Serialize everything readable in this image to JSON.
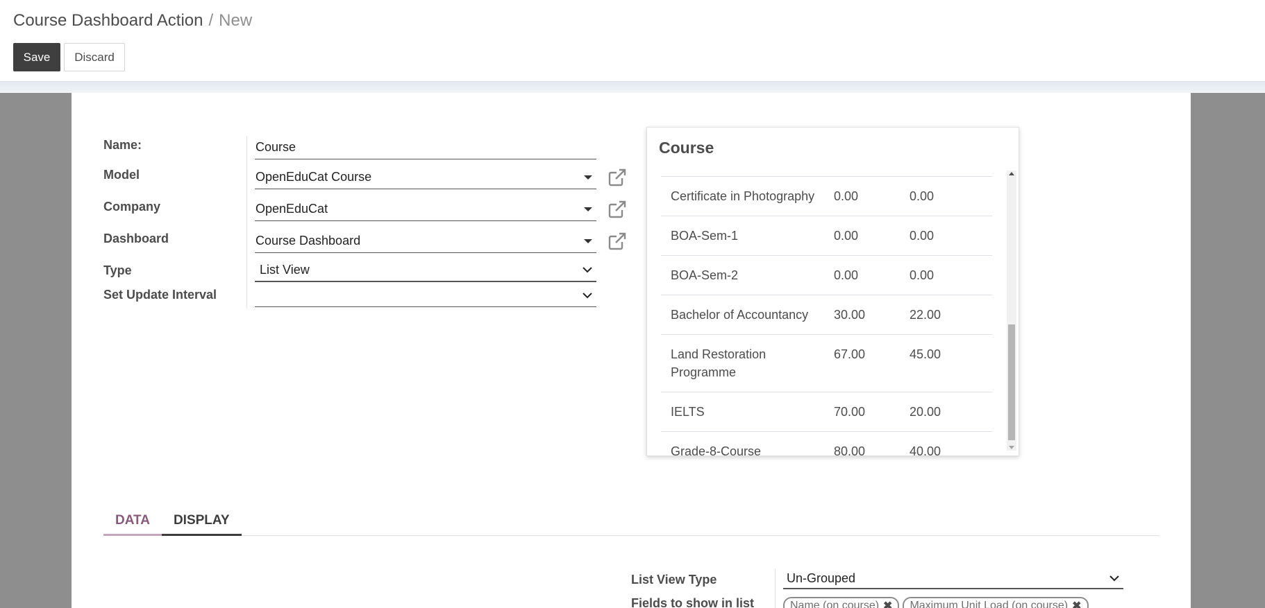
{
  "breadcrumb": {
    "parent": "Course Dashboard Action",
    "separator": "/",
    "current": "New"
  },
  "buttons": {
    "save": "Save",
    "discard": "Discard"
  },
  "form": {
    "name": {
      "label": "Name:",
      "value": "Course"
    },
    "model": {
      "label": "Model",
      "value": "OpenEduCat Course"
    },
    "company": {
      "label": "Company",
      "value": "OpenEduCat"
    },
    "dashboard": {
      "label": "Dashboard",
      "value": "Course Dashboard"
    },
    "type": {
      "label": "Type",
      "value": "List View"
    },
    "update_interval": {
      "label": "Set Update Interval",
      "value": ""
    }
  },
  "preview": {
    "title": "Course",
    "rows": [
      {
        "name": "Certificate in Photography",
        "v1": "0.00",
        "v2": "0.00"
      },
      {
        "name": "BOA-Sem-1",
        "v1": "0.00",
        "v2": "0.00"
      },
      {
        "name": "BOA-Sem-2",
        "v1": "0.00",
        "v2": "0.00"
      },
      {
        "name": "Bachelor of Accountancy",
        "v1": "30.00",
        "v2": "22.00"
      },
      {
        "name": "Land Restoration Programme",
        "v1": "67.00",
        "v2": "45.00"
      },
      {
        "name": "IELTS",
        "v1": "70.00",
        "v2": "20.00"
      },
      {
        "name": "Grade-8-Course",
        "v1": "80.00",
        "v2": "40.00"
      }
    ]
  },
  "tabs": {
    "data": "DATA",
    "display": "DISPLAY"
  },
  "lower": {
    "list_view_type": {
      "label": "List View Type",
      "value": "Un-Grouped"
    },
    "fields_in_list": {
      "label": "Fields to show in list",
      "tags": [
        "Name (on course)",
        "Maximum Unit Load (on course)"
      ]
    }
  },
  "colors": {
    "accent": "#875a7b",
    "primary_button": "#3f3f3f",
    "backdrop": "#8e8e8e"
  }
}
